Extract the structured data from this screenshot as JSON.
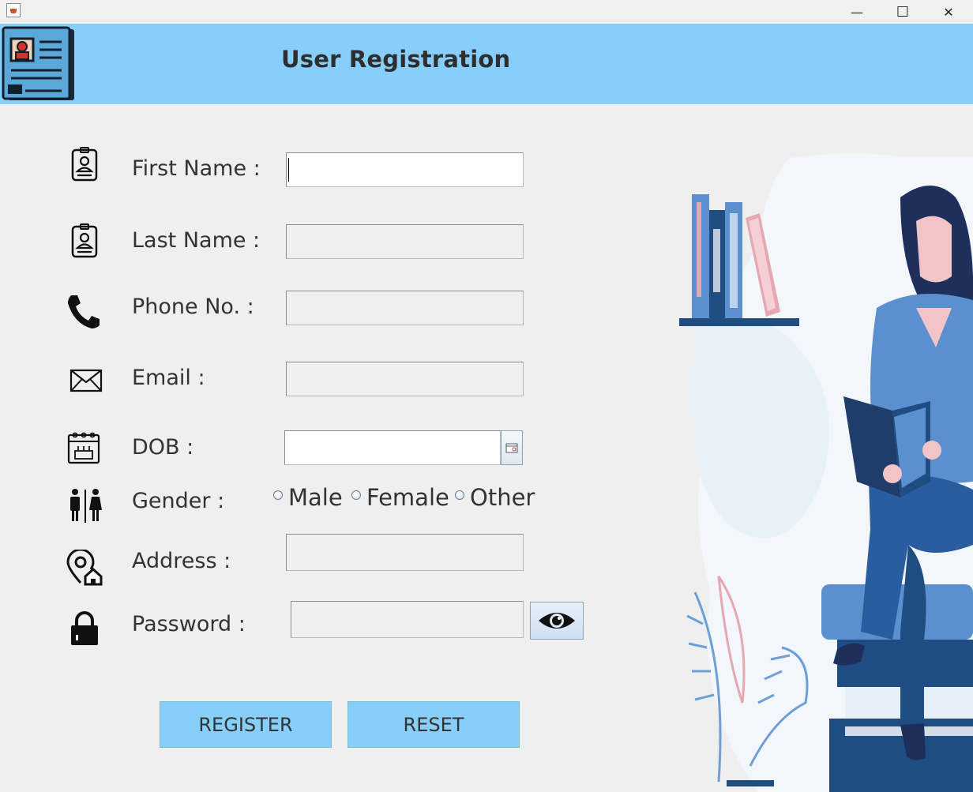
{
  "window": {
    "minimize": "—",
    "maximize": "☐",
    "close": "✕"
  },
  "header": {
    "title": "User Registration"
  },
  "form": {
    "first_name": {
      "label": "First Name :",
      "value": ""
    },
    "last_name": {
      "label": "Last Name :",
      "value": ""
    },
    "phone": {
      "label": "Phone No. :",
      "value": ""
    },
    "email": {
      "label": "Email :",
      "value": ""
    },
    "dob": {
      "label": "DOB :",
      "value": ""
    },
    "gender": {
      "label": "Gender :",
      "options": [
        "Male",
        "Female",
        "Other"
      ]
    },
    "address": {
      "label": "Address :",
      "value": ""
    },
    "password": {
      "label": "Password :",
      "value": ""
    }
  },
  "buttons": {
    "register": "REGISTER",
    "reset": "RESET"
  },
  "colors": {
    "header_bg": "#87cefa",
    "button_bg": "#87cefa",
    "page_bg": "#efefef"
  }
}
